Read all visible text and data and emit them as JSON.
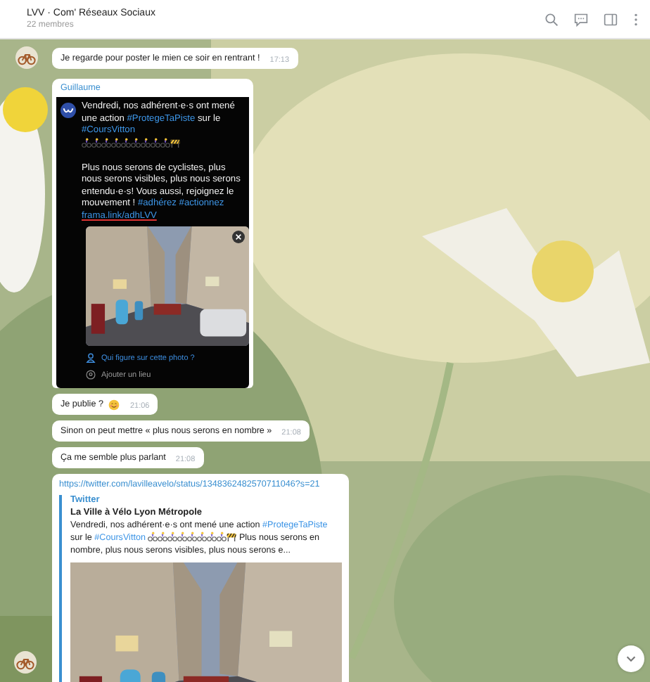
{
  "header": {
    "title": "LVV · Com' Réseaux Sociaux",
    "subtitle": "22 membres"
  },
  "messages": [
    {
      "kind": "text",
      "text": "Je regarde pour poster le mien ce soir en rentrant !",
      "time": "17:13",
      "avatar": true
    },
    {
      "kind": "post",
      "sender": "Guillaume",
      "segments": [
        {
          "kind": "text",
          "text": "Vendredi, nos adhérent·e·s ont mené une action "
        },
        {
          "kind": "tag",
          "text": "#ProtegeTaPiste"
        },
        {
          "kind": "text",
          "text": " sur le "
        },
        {
          "kind": "tag",
          "text": "#CoursVitton"
        },
        {
          "kind": "break"
        },
        {
          "kind": "cyclist"
        },
        {
          "kind": "cyclist"
        },
        {
          "kind": "cyclist"
        },
        {
          "kind": "cyclist"
        },
        {
          "kind": "cyclist"
        },
        {
          "kind": "cyclist"
        },
        {
          "kind": "cyclist"
        },
        {
          "kind": "cyclist"
        },
        {
          "kind": "cyclist"
        },
        {
          "kind": "barrier"
        },
        {
          "kind": "break"
        },
        {
          "kind": "break"
        },
        {
          "kind": "text",
          "text": "Plus nous serons de cyclistes, plus nous serons visibles, plus nous serons entendu·e·s! Vous aussi, rejoignez le mouvement ! "
        },
        {
          "kind": "tag",
          "text": "#adhérez"
        },
        {
          "kind": "space"
        },
        {
          "kind": "tag",
          "text": "#actionnez"
        },
        {
          "kind": "break"
        },
        {
          "kind": "link",
          "text": "frama.link/adhLVV"
        }
      ],
      "tag_people": "Qui figure sur cette photo ?",
      "add_place": "Ajouter un lieu"
    },
    {
      "kind": "text",
      "text": "Je publie ?",
      "smiley": true,
      "time": "21:06"
    },
    {
      "kind": "text",
      "text": "Sinon on peut mettre « plus nous serons en nombre »",
      "time": "21:08"
    },
    {
      "kind": "text",
      "text": "Ça me semble plus parlant",
      "time": "21:08"
    },
    {
      "kind": "link-preview",
      "url": "https://twitter.com/lavilleavelo/status/1348362482570711046?s=21",
      "site": "Twitter",
      "title": "La Ville à Vélo Lyon Métropole",
      "segments": [
        {
          "kind": "text",
          "text": "Vendredi, nos adhérent·e·s ont mené une action "
        },
        {
          "kind": "tag",
          "text": "#ProtegeTaPiste"
        },
        {
          "kind": "text",
          "text": " sur le "
        },
        {
          "kind": "tag",
          "text": "#CoursVitton"
        },
        {
          "kind": "space"
        },
        {
          "kind": "cyclist"
        },
        {
          "kind": "cyclist"
        },
        {
          "kind": "cyclist"
        },
        {
          "kind": "cyclist"
        },
        {
          "kind": "cyclist"
        },
        {
          "kind": "cyclist"
        },
        {
          "kind": "cyclist"
        },
        {
          "kind": "cyclist"
        },
        {
          "kind": "barrier"
        },
        {
          "kind": "text",
          "text": " Plus nous serons en nombre, plus nous serons visibles, plus nous serons e..."
        }
      ],
      "avatar": true
    }
  ]
}
